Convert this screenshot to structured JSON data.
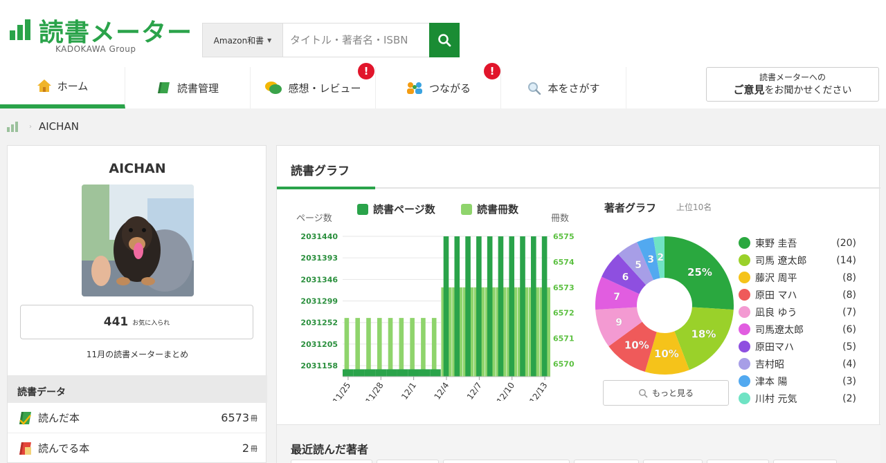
{
  "logo": {
    "title": "読書メーター",
    "subtitle": "KADOKAWA Group"
  },
  "search": {
    "scope": "Amazon和書",
    "placeholder": "タイトル・著者名・ISBN",
    "search_icon": "search-icon"
  },
  "nav": [
    {
      "label": "ホーム",
      "icon": "home-icon",
      "active": true
    },
    {
      "label": "読書管理",
      "icon": "book-icon"
    },
    {
      "label": "感想・レビュー",
      "icon": "chat-icon",
      "badge": "!"
    },
    {
      "label": "つながる",
      "icon": "people-icon",
      "badge": "!"
    },
    {
      "label": "本をさがす",
      "icon": "search-icon"
    }
  ],
  "feedback": {
    "line1": "読書メーターへの",
    "line2_bold": "ご意見",
    "line2_rest": "をお聞かせください"
  },
  "breadcrumb": {
    "user": "AICHAN"
  },
  "profile": {
    "name": "AICHAN",
    "favorites_count": "441",
    "favorites_label": "お気に入られ",
    "summary_link": "11月の読書メーターまとめ",
    "data_heading": "読書データ",
    "rows": [
      {
        "label": "読んだ本",
        "value": "6573",
        "unit": "冊"
      },
      {
        "label": "読んでる本",
        "value": "2",
        "unit": "冊"
      }
    ]
  },
  "graph": {
    "tab_title": "読書グラフ",
    "legend_pages": "読書ページ数",
    "legend_books": "読書冊数",
    "left_unit": "ページ数",
    "right_unit": "冊数",
    "colors": {
      "pages": "#2aa34a",
      "books": "#8fd46c"
    }
  },
  "chart_data": [
    {
      "type": "bar",
      "x": [
        "11/25",
        "11/26",
        "11/27",
        "11/28",
        "11/29",
        "11/30",
        "12/1",
        "12/2",
        "12/3",
        "12/4",
        "12/5",
        "12/6",
        "12/7",
        "12/8",
        "12/9",
        "12/10",
        "12/11",
        "12/12",
        "12/13"
      ],
      "xticks": [
        "11/25",
        "11/28",
        "12/1",
        "12/4",
        "12/7",
        "12/10",
        "12/13"
      ],
      "series": [
        {
          "name": "読書ページ数",
          "axis": "left",
          "values": [
            2031150,
            2031150,
            2031150,
            2031150,
            2031150,
            2031150,
            2031150,
            2031150,
            2031150,
            2031440,
            2031440,
            2031440,
            2031440,
            2031440,
            2031440,
            2031440,
            2031440,
            2031440,
            2031440
          ]
        },
        {
          "name": "読書冊数",
          "axis": "right",
          "values": [
            6571.8,
            6571.8,
            6571.8,
            6571.8,
            6571.8,
            6571.8,
            6571.8,
            6571.8,
            6571.8,
            6573,
            6573,
            6573,
            6573,
            6573,
            6573,
            6573,
            6573,
            6573,
            6573
          ]
        }
      ],
      "yticks_left": [
        "2031440",
        "2031393",
        "2031346",
        "2031299",
        "2031252",
        "2031205",
        "2031158"
      ],
      "yticks_right": [
        "6575",
        "6574",
        "6573",
        "6572",
        "6571",
        "6570"
      ],
      "ylim_left": [
        2031134,
        2031440
      ],
      "ylim_right": [
        6569.5,
        6575
      ],
      "xlabel": "",
      "ylabel": "ページ数",
      "y2label": "冊数"
    },
    {
      "type": "pie",
      "title": "著者グラフ",
      "subtitle": "上位10名",
      "donut": true,
      "categories": [
        "東野 圭吾",
        "司馬 遼太郎",
        "藤沢 周平",
        "原田 マハ",
        "凪良 ゆう",
        "司馬遼太郎",
        "原田マハ",
        "吉村昭",
        "津本 陽",
        "川村 元気"
      ],
      "counts": [
        20,
        14,
        8,
        8,
        7,
        6,
        5,
        4,
        3,
        2
      ],
      "slice_labels": [
        "25%",
        "18%",
        "10%",
        "10%",
        "9",
        "7",
        "6",
        "5",
        "3",
        "2"
      ],
      "colors": [
        "#2aa83f",
        "#9ad12a",
        "#f5c31a",
        "#ef5a5a",
        "#f39ad2",
        "#e15de0",
        "#8e4fe0",
        "#a79ee7",
        "#52a9f0",
        "#6fe3c4"
      ]
    }
  ],
  "author_more": "もっと見る",
  "recent_authors_title": "最近読んだ著者"
}
